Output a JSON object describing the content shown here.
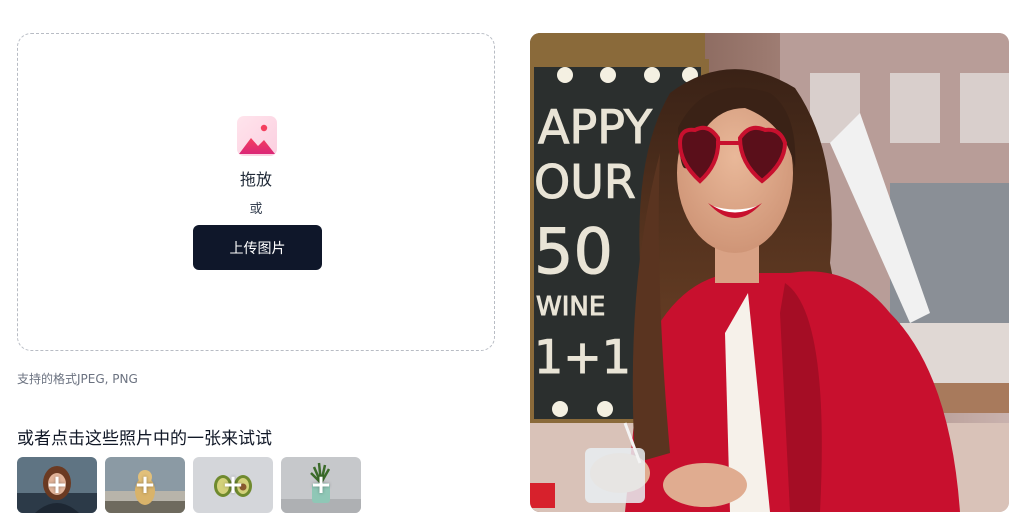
{
  "upload": {
    "icon": "image-icon",
    "drag_label": "拖放",
    "or_label": "或",
    "button_label": "上传图片"
  },
  "formats_text": "支持的格式JPEG, PNG",
  "samples": {
    "title": "或者点击这些照片中的一张来试试",
    "items": [
      {
        "name": "sample-woman",
        "plus": "+"
      },
      {
        "name": "sample-dog",
        "plus": "+"
      },
      {
        "name": "sample-avocado",
        "plus": "+"
      },
      {
        "name": "sample-plant",
        "plus": "+"
      }
    ]
  },
  "preview": {
    "sign_text_1": "APPY",
    "sign_text_2": "OUR",
    "sign_text_3": "50",
    "sign_text_4": "WINE",
    "sign_text_5": "1+1"
  },
  "colors": {
    "button_bg": "#0f172a",
    "icon_gradient_start": "#f43f5e",
    "icon_gradient_end": "#ec4899",
    "jacket": "#c8102e"
  }
}
